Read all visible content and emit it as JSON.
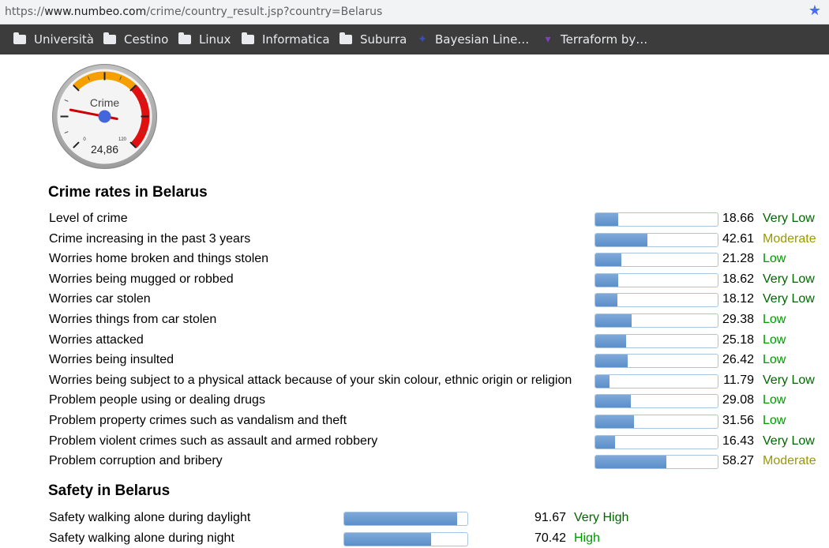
{
  "browser": {
    "url_prefix": "https://",
    "url_host": "www.numbeo.com",
    "url_path": "/crime/country_result.jsp?country=Belarus",
    "bookmarks": [
      {
        "label": "Università",
        "icon": "folder-icon"
      },
      {
        "label": "Cestino",
        "icon": "folder-icon"
      },
      {
        "label": "Linux",
        "icon": "folder-icon"
      },
      {
        "label": "Informatica",
        "icon": "folder-icon"
      },
      {
        "label": "Suburra",
        "icon": "folder-icon"
      },
      {
        "label": "Bayesian Line…",
        "icon": "site-icon"
      },
      {
        "label": "Terraform by…",
        "icon": "terraform-icon"
      }
    ]
  },
  "gauge": {
    "title": "Crime",
    "value_text": "24,86",
    "value": 24.86,
    "min_label": "0",
    "max_label": "120",
    "max": 120
  },
  "crime_section": {
    "title": "Crime rates in Belarus",
    "rows": [
      {
        "label": "Level of crime",
        "value": "18.66",
        "rating": "Very Low",
        "color": "#006600"
      },
      {
        "label": "Crime increasing in the past 3 years",
        "value": "42.61",
        "rating": "Moderate",
        "color": "#999900"
      },
      {
        "label": "Worries home broken and things stolen",
        "value": "21.28",
        "rating": "Low",
        "color": "#009900"
      },
      {
        "label": "Worries being mugged or robbed",
        "value": "18.62",
        "rating": "Very Low",
        "color": "#006600"
      },
      {
        "label": "Worries car stolen",
        "value": "18.12",
        "rating": "Very Low",
        "color": "#006600"
      },
      {
        "label": "Worries things from car stolen",
        "value": "29.38",
        "rating": "Low",
        "color": "#009900"
      },
      {
        "label": "Worries attacked",
        "value": "25.18",
        "rating": "Low",
        "color": "#009900"
      },
      {
        "label": "Worries being insulted",
        "value": "26.42",
        "rating": "Low",
        "color": "#009900"
      },
      {
        "label": "Worries being subject to a physical attack because of your skin colour, ethnic origin or religion",
        "value": "11.79",
        "rating": "Very Low",
        "color": "#006600"
      },
      {
        "label": "Problem people using or dealing drugs",
        "value": "29.08",
        "rating": "Low",
        "color": "#009900"
      },
      {
        "label": "Problem property crimes such as vandalism and theft",
        "value": "31.56",
        "rating": "Low",
        "color": "#009900"
      },
      {
        "label": "Problem violent crimes such as assault and armed robbery",
        "value": "16.43",
        "rating": "Very Low",
        "color": "#006600"
      },
      {
        "label": "Problem corruption and bribery",
        "value": "58.27",
        "rating": "Moderate",
        "color": "#999900"
      }
    ]
  },
  "safety_section": {
    "title": "Safety in Belarus",
    "rows": [
      {
        "label": "Safety walking alone during daylight",
        "value": "91.67",
        "rating": "Very High",
        "color": "#006600"
      },
      {
        "label": "Safety walking alone during night",
        "value": "70.42",
        "rating": "High",
        "color": "#009900"
      }
    ]
  }
}
